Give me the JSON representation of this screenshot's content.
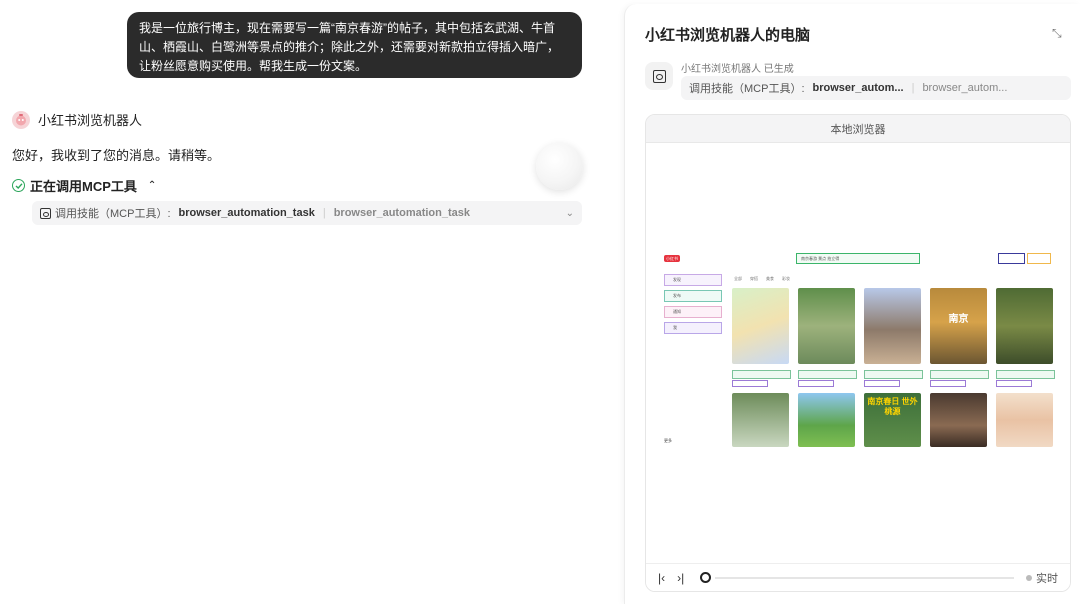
{
  "chat": {
    "user_message": "我是一位旅行博主，现在需要写一篇“南京春游”的帖子，其中包括玄武湖、牛首山、栖霞山、白鹭洲等景点的推介；除此之外，还需要对新款拍立得插入暗广，让粉丝愿意购买使用。帮我生成一份文案。",
    "bot_name": "小红书浏览机器人",
    "bot_reply": "您好，我收到了您的消息。请稍等。",
    "mcp_status": "正在调用MCP工具",
    "skill_prefix": "调用技能（MCP工具）:",
    "skill_name": "browser_automation_task",
    "skill_name_2": "browser_automation_task"
  },
  "panel": {
    "title": "小红书浏览机器人的电脑",
    "generated_label": "小红书浏览机器人 已生成",
    "skill_prefix": "调用技能（MCP工具）:",
    "skill_name": "browser_autom...",
    "skill_name_2": "browser_autom...",
    "browser_title": "本地浏览器",
    "live_label": "实时"
  },
  "mini_page": {
    "logo": "小红书",
    "search_placeholder": "南京春游 景点 拍立得",
    "side_items": [
      "发现",
      "发布",
      "通知",
      "我"
    ],
    "tabs": [
      "全部",
      "穿搭",
      "美食",
      "彩妆"
    ],
    "tile4_text": "南京",
    "tile8_text": "南京春日 世外桃源",
    "more_label": "更多"
  }
}
